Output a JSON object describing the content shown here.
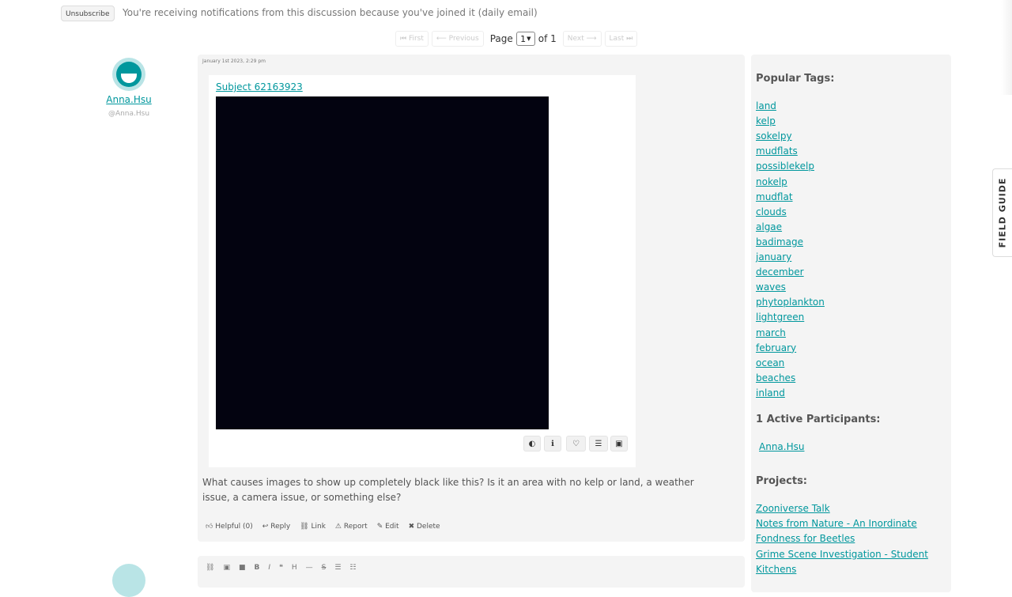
{
  "notification": {
    "unsubscribe_label": "Unsubscribe",
    "message": "You're receiving notifications from this discussion because you've joined it (daily email)"
  },
  "pagination": {
    "first": "⏮ First",
    "previous": "⟵ Previous",
    "page_label": "Page",
    "current_page": "1",
    "of_label": "of 1",
    "next": "Next ⟶",
    "last": "Last ⏭"
  },
  "author": {
    "display_name": "Anna.Hsu",
    "handle": "@Anna.Hsu"
  },
  "post": {
    "timestamp": "January 1st 2023, 2:29 pm",
    "subject_link": "Subject 62163923",
    "body": "What causes images to show up completely black like this? Is it an area with no kelp or land, a weather issue, a camera issue, or something else?",
    "image_tools": [
      "contrast-icon",
      "info-icon",
      "heart-icon",
      "list-icon",
      "image-icon"
    ],
    "actions": {
      "helpful": "Helpful (0)",
      "reply": "Reply",
      "link": "Link",
      "report": "Report",
      "edit": "Edit",
      "delete": "Delete"
    }
  },
  "editor": {
    "tools": [
      "link-icon",
      "image-icon",
      "video-icon",
      "bold-icon",
      "italic-icon",
      "quote-icon",
      "heading-icon",
      "rule-icon",
      "strikethrough-icon",
      "bullet-list-icon",
      "numbered-list-icon"
    ]
  },
  "sidebar": {
    "popular_tags_heading": "Popular Tags:",
    "tags": [
      "land",
      "kelp",
      "sokelpy",
      "mudflats",
      "possiblekelp",
      "nokelp",
      "mudflat",
      "clouds",
      "algae",
      "badimage",
      "january",
      "december",
      "waves",
      "phytoplankton",
      "lightgreen",
      "march",
      "february",
      "ocean",
      "beaches",
      "inland"
    ],
    "participants_heading": "1 Active Participants:",
    "participants": [
      "Anna.Hsu"
    ],
    "projects_heading": "Projects:",
    "projects": [
      "Zooniverse Talk",
      "Notes from Nature - An Inordinate ",
      "Fondness for Beetles",
      "Grime Scene Investigation - Student ",
      "Kitchens"
    ]
  },
  "field_guide": {
    "label": "FIELD GUIDE"
  },
  "colors": {
    "accent": "#00979d",
    "panel": "#f4f4f4",
    "image": "#030310"
  }
}
